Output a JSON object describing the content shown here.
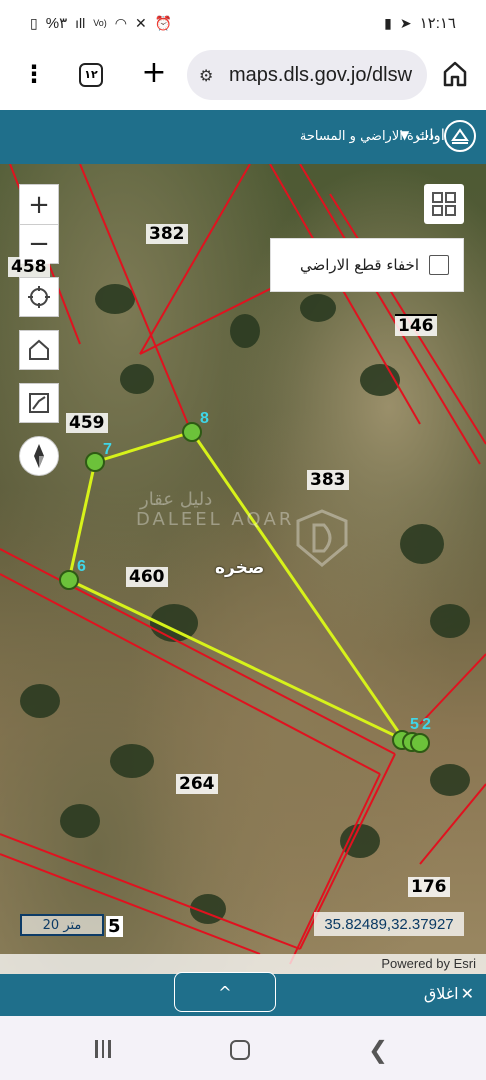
{
  "status_bar": {
    "battery": "%٣",
    "time": "١٢:١٦"
  },
  "browser": {
    "tab_count": "١٢",
    "url": "maps.dls.gov.jo/dlsw"
  },
  "app_header": {
    "tools_label": "اداوات",
    "org_title": "دائرة الاراضي و المساحة"
  },
  "map": {
    "hide_parcels_label": "اخفاء قطع الاراضي",
    "hide_parcels_checked": false,
    "parcel_labels": [
      "382",
      "458",
      "146",
      "459",
      "383",
      "460",
      "264",
      "176"
    ],
    "point_labels": [
      "8",
      "7",
      "6",
      "5",
      "2"
    ],
    "place_name": "صخره",
    "watermark_ar": "دليل عقار",
    "watermark_en": "DALEEL AQAR",
    "scale_label": "20 متر",
    "scale_extra": "5",
    "coordinates": "35.82489,32.37927",
    "attribution": "Powered by Esri"
  },
  "drawer": {
    "toggle_label": "^",
    "close_label": "اغلاق"
  }
}
